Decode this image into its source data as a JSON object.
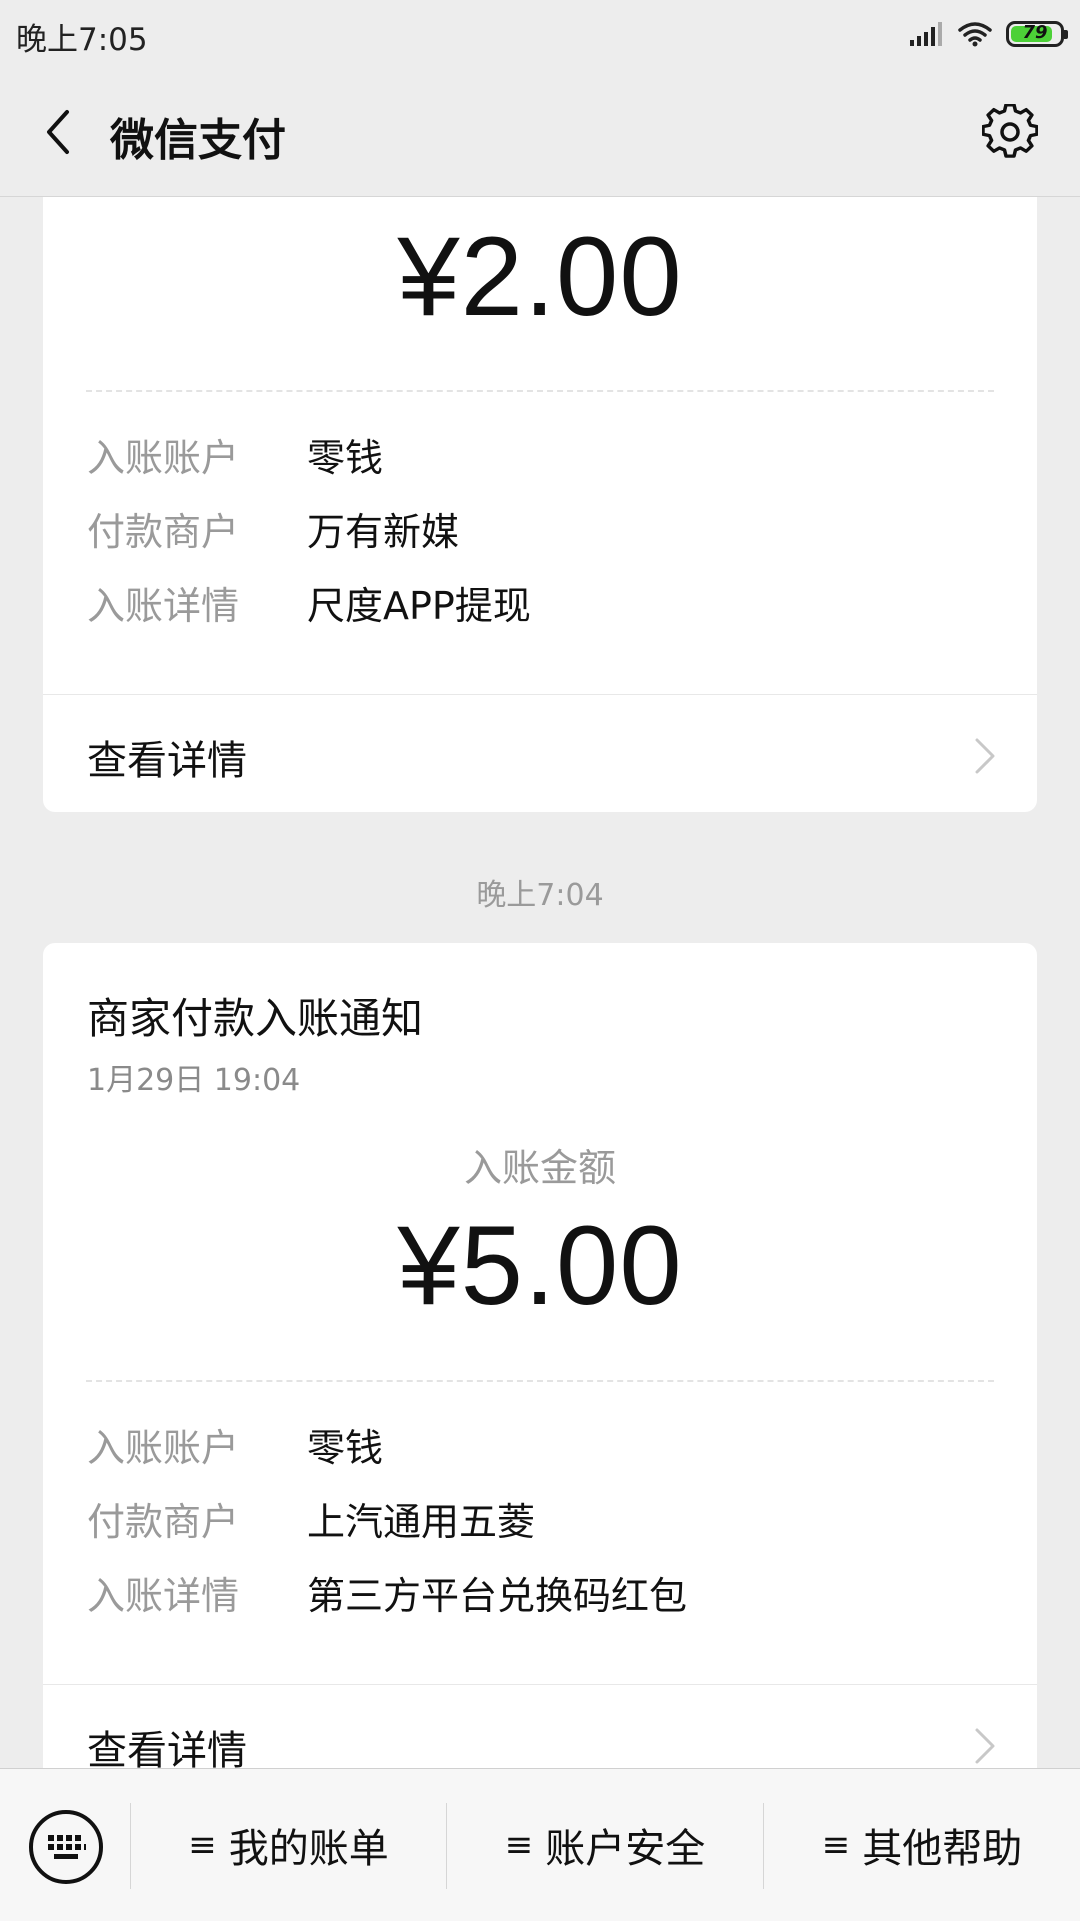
{
  "status_bar": {
    "time": "晚上7:05",
    "battery": "79"
  },
  "header": {
    "title": "微信支付"
  },
  "card1": {
    "amount": "¥2.00",
    "rows": [
      {
        "label": "入账账户",
        "value": "零钱"
      },
      {
        "label": "付款商户",
        "value": "万有新媒"
      },
      {
        "label": "入账详情",
        "value": "尺度APP提现"
      }
    ],
    "detail_link": "查看详情"
  },
  "time_separator": "晚上7:04",
  "card2": {
    "title": "商家付款入账通知",
    "date": "1月29日  19:04",
    "amount_label": "入账金额",
    "amount": "¥5.00",
    "rows": [
      {
        "label": "入账账户",
        "value": "零钱"
      },
      {
        "label": "付款商户",
        "value": "上汽通用五菱"
      },
      {
        "label": "入账详情",
        "value": "第三方平台兑换码红包"
      }
    ],
    "detail_link": "查看详情"
  },
  "bottom_menu": {
    "items": [
      {
        "label": "我的账单"
      },
      {
        "label": "账户安全"
      },
      {
        "label": "其他帮助"
      }
    ],
    "menu_glyph": "≡"
  },
  "colors": {
    "accent_green": "#4cd137",
    "background": "#ededed",
    "muted_text": "#9a9a9a"
  }
}
